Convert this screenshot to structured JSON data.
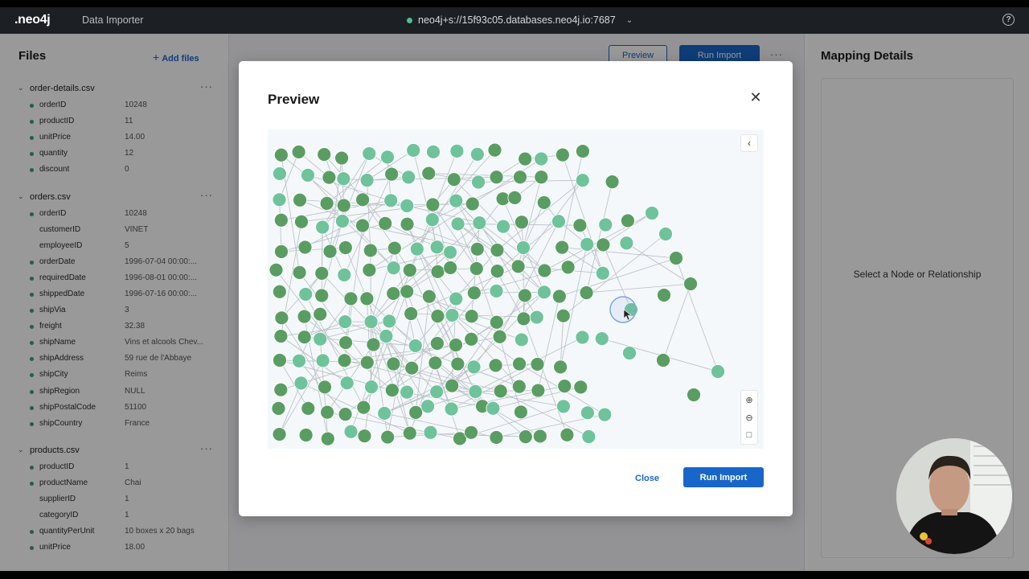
{
  "topbar": {
    "logo": ".neo4j",
    "app_name": "Data Importer",
    "connection": "neo4j+s://15f93c05.databases.neo4j.io:7687",
    "help": "?"
  },
  "files_panel": {
    "title": "Files",
    "add_files": "Add files",
    "files": [
      {
        "name": "order-details.csv",
        "fields": [
          {
            "name": "orderID",
            "value": "10248",
            "dot": true
          },
          {
            "name": "productID",
            "value": "11",
            "dot": true
          },
          {
            "name": "unitPrice",
            "value": "14.00",
            "dot": true
          },
          {
            "name": "quantity",
            "value": "12",
            "dot": true
          },
          {
            "name": "discount",
            "value": "0",
            "dot": true
          }
        ]
      },
      {
        "name": "orders.csv",
        "fields": [
          {
            "name": "orderID",
            "value": "10248",
            "dot": true
          },
          {
            "name": "customerID",
            "value": "VINET",
            "dot": false
          },
          {
            "name": "employeeID",
            "value": "5",
            "dot": false
          },
          {
            "name": "orderDate",
            "value": "1996-07-04 00:00:...",
            "dot": true
          },
          {
            "name": "requiredDate",
            "value": "1996-08-01 00:00:...",
            "dot": true
          },
          {
            "name": "shippedDate",
            "value": "1996-07-16 00:00:...",
            "dot": true
          },
          {
            "name": "shipVia",
            "value": "3",
            "dot": true
          },
          {
            "name": "freight",
            "value": "32.38",
            "dot": true
          },
          {
            "name": "shipName",
            "value": "Vins et alcools Chev...",
            "dot": true
          },
          {
            "name": "shipAddress",
            "value": "59 rue de l'Abbaye",
            "dot": true
          },
          {
            "name": "shipCity",
            "value": "Reims",
            "dot": true
          },
          {
            "name": "shipRegion",
            "value": "NULL",
            "dot": true
          },
          {
            "name": "shipPostalCode",
            "value": "51100",
            "dot": true
          },
          {
            "name": "shipCountry",
            "value": "France",
            "dot": true
          }
        ]
      },
      {
        "name": "products.csv",
        "fields": [
          {
            "name": "productID",
            "value": "1",
            "dot": true
          },
          {
            "name": "productName",
            "value": "Chai",
            "dot": true
          },
          {
            "name": "supplierID",
            "value": "1",
            "dot": false
          },
          {
            "name": "categoryID",
            "value": "1",
            "dot": false
          },
          {
            "name": "quantityPerUnit",
            "value": "10 boxes x 20 bags",
            "dot": true
          },
          {
            "name": "unitPrice",
            "value": "18.00",
            "dot": true
          }
        ]
      }
    ]
  },
  "toolbar": {
    "preview_label": "Preview",
    "run_import_label": "Run Import"
  },
  "mapping": {
    "title": "Mapping Details",
    "empty": "Select a Node or Relationship"
  },
  "modal": {
    "title": "Preview",
    "close_label": "Close",
    "run_import_label": "Run Import"
  },
  "colors": {
    "accent": "#1866c9",
    "node_dark": "#5a9d62",
    "node_light": "#6fc39a",
    "topbar": "#1c1f24"
  },
  "icons": [
    "close-icon",
    "collapse-panel-icon",
    "zoom-in-icon",
    "zoom-out-icon",
    "fit-view-icon",
    "help-icon",
    "chevron-down-icon",
    "plus-icon"
  ]
}
